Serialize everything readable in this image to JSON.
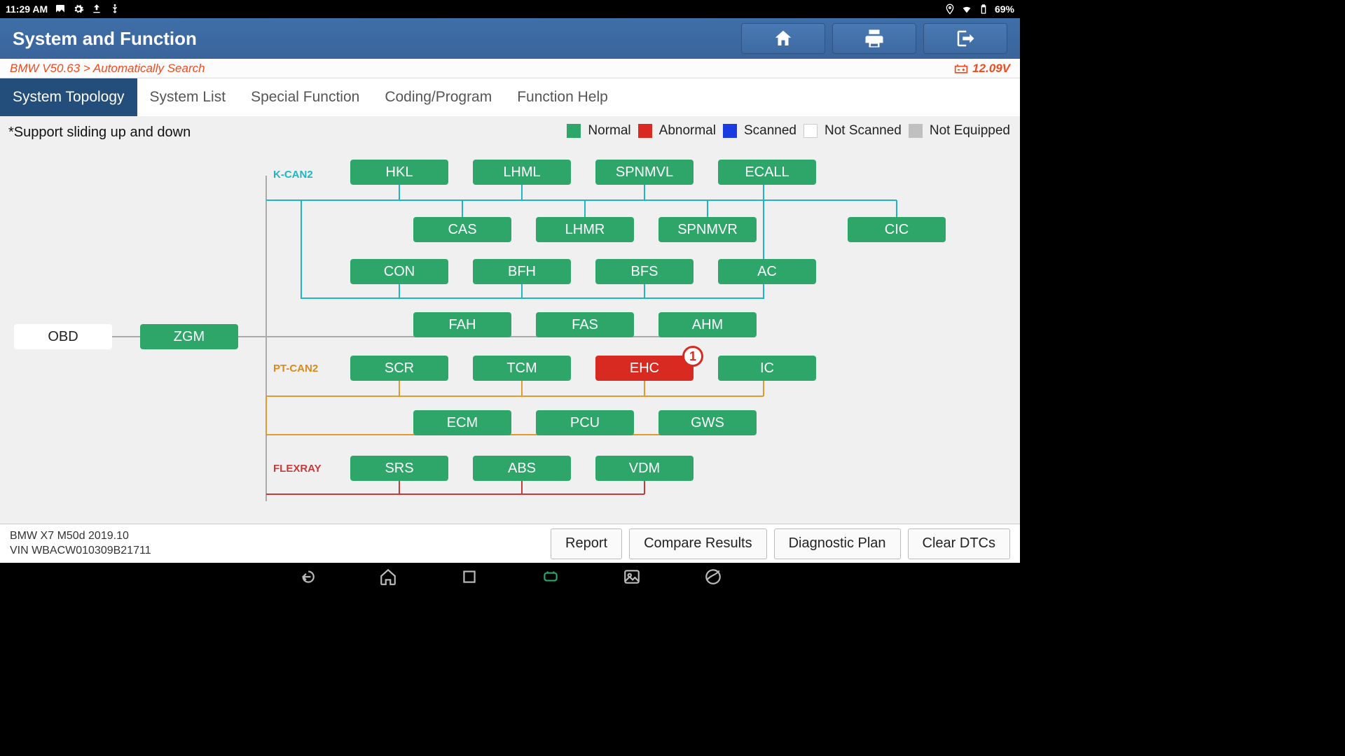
{
  "status": {
    "time": "11:29 AM",
    "battery": "69%"
  },
  "header": {
    "title": "System and Function"
  },
  "breadcrumb": {
    "text": "BMW V50.63 > Automatically Search",
    "voltage": "12.09V"
  },
  "tabs": {
    "items": [
      {
        "label": "System Topology",
        "active": true
      },
      {
        "label": "System List",
        "active": false
      },
      {
        "label": "Special Function",
        "active": false
      },
      {
        "label": "Coding/Program",
        "active": false
      },
      {
        "label": "Function Help",
        "active": false
      }
    ]
  },
  "hint": "*Support sliding up and down",
  "legend": {
    "items": [
      {
        "label": "Normal",
        "color": "#2ea66a"
      },
      {
        "label": "Abnormal",
        "color": "#d82a20"
      },
      {
        "label": "Scanned",
        "color": "#1a3be0"
      },
      {
        "label": "Not Scanned",
        "color": "#ffffff"
      },
      {
        "label": "Not Equipped",
        "color": "#c0c0c0"
      }
    ]
  },
  "buses": {
    "kcan2": "K-CAN2",
    "ptcan2": "PT-CAN2",
    "flexray": "FLEXRAY"
  },
  "nodes": {
    "obd": {
      "label": "OBD",
      "status": "notscanned"
    },
    "zgm": {
      "label": "ZGM",
      "status": "normal"
    },
    "hkl": {
      "label": "HKL",
      "status": "normal"
    },
    "lhml": {
      "label": "LHML",
      "status": "normal"
    },
    "spnmvl": {
      "label": "SPNMVL",
      "status": "normal"
    },
    "ecall": {
      "label": "ECALL",
      "status": "normal"
    },
    "cas": {
      "label": "CAS",
      "status": "normal"
    },
    "lhmr": {
      "label": "LHMR",
      "status": "normal"
    },
    "spnmvr": {
      "label": "SPNMVR",
      "status": "normal"
    },
    "cic": {
      "label": "CIC",
      "status": "normal"
    },
    "con": {
      "label": "CON",
      "status": "normal"
    },
    "bfh": {
      "label": "BFH",
      "status": "normal"
    },
    "bfs": {
      "label": "BFS",
      "status": "normal"
    },
    "ac": {
      "label": "AC",
      "status": "normal"
    },
    "fah": {
      "label": "FAH",
      "status": "normal"
    },
    "fas": {
      "label": "FAS",
      "status": "normal"
    },
    "ahm": {
      "label": "AHM",
      "status": "normal"
    },
    "scr": {
      "label": "SCR",
      "status": "normal"
    },
    "tcm": {
      "label": "TCM",
      "status": "normal"
    },
    "ehc": {
      "label": "EHC",
      "status": "abnormal",
      "dtc": "1"
    },
    "ic": {
      "label": "IC",
      "status": "normal"
    },
    "ecm": {
      "label": "ECM",
      "status": "normal"
    },
    "pcu": {
      "label": "PCU",
      "status": "normal"
    },
    "gws": {
      "label": "GWS",
      "status": "normal"
    },
    "srs": {
      "label": "SRS",
      "status": "normal"
    },
    "abs": {
      "label": "ABS",
      "status": "normal"
    },
    "vdm": {
      "label": "VDM",
      "status": "normal"
    }
  },
  "footer": {
    "vehicle_line1": "BMW X7 M50d 2019.10",
    "vehicle_line2": "VIN WBACW010309B21711",
    "buttons": {
      "report": "Report",
      "compare": "Compare Results",
      "plan": "Diagnostic Plan",
      "clear": "Clear DTCs"
    }
  }
}
